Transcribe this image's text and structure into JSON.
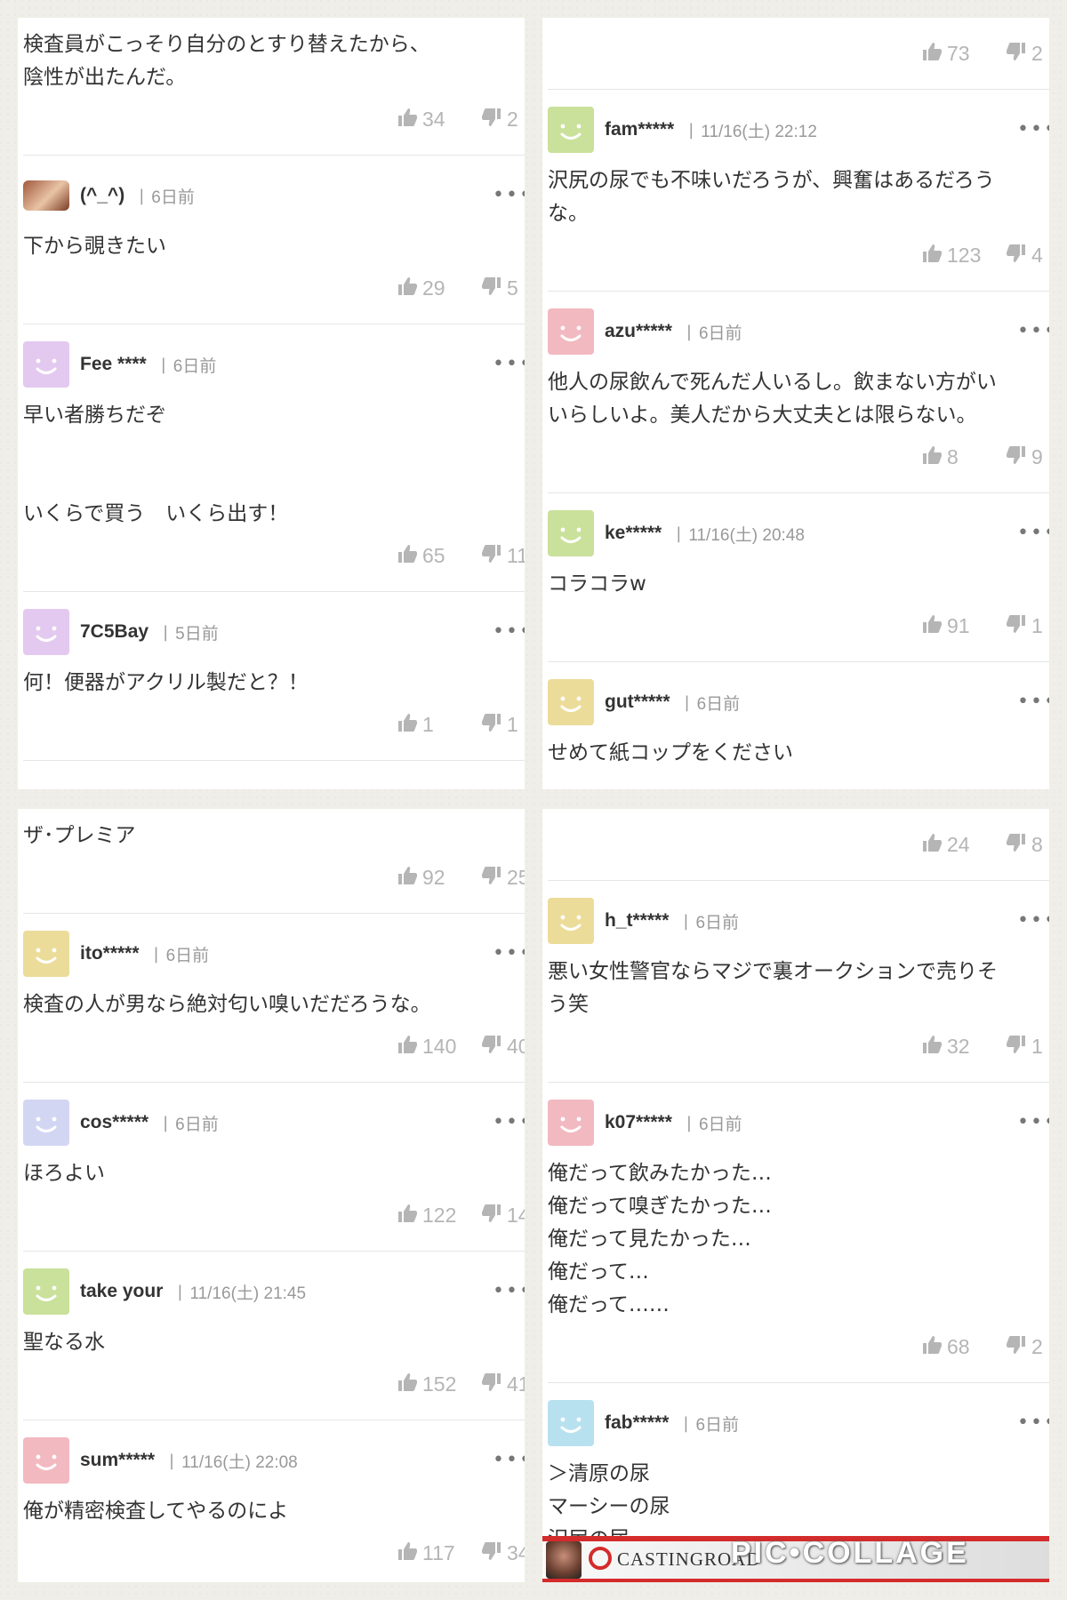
{
  "panels": [
    {
      "comments": [
        {
          "type": "cont",
          "text": "検査員がこっそり自分のとすり替えたから、\n陰性が出たんだ。",
          "up": "34",
          "down": "2"
        },
        {
          "user": "(^_^)",
          "time": "6日前",
          "avatar": "photo",
          "text": "下から覗きたい",
          "up": "29",
          "down": "5"
        },
        {
          "user": "Fee ****",
          "time": "6日前",
          "avatar": "#e3c9ef",
          "text": "早い者勝ちだぞ\n\n\nいくらで買う　いくら出す！",
          "up": "65",
          "down": "11"
        },
        {
          "user": "7C5Bay",
          "time": "5日前",
          "avatar": "#e3c9ef",
          "text": "何！便器がアクリル製だと？！",
          "up": "1",
          "down": "1"
        }
      ]
    },
    {
      "comments": [
        {
          "type": "votes-only",
          "up": "73",
          "down": "2"
        },
        {
          "user": "fam*****",
          "time": "11/16(土) 22:12",
          "avatar": "#c9e19a",
          "text": "沢尻の尿でも不味いだろうが、興奮はあるだろう\nな。",
          "up": "123",
          "down": "4"
        },
        {
          "user": "azu*****",
          "time": "6日前",
          "avatar": "#f2b9c0",
          "text": "他人の尿飲んで死んだ人いるし。飲まない方がい\nいらしいよ。美人だから大丈夫とは限らない。",
          "up": "8",
          "down": "9"
        },
        {
          "user": "ke*****",
          "time": "11/16(土) 20:48",
          "avatar": "#c9e19a",
          "text": "コラコラw",
          "up": "91",
          "down": "1"
        },
        {
          "user": "gut*****",
          "time": "6日前",
          "avatar": "#ecdc9a",
          "text": "せめて紙コップをください",
          "up": "",
          "down": ""
        }
      ]
    },
    {
      "comments": [
        {
          "type": "cont",
          "text": "ザ･プレミア",
          "up": "92",
          "down": "25"
        },
        {
          "user": "ito*****",
          "time": "6日前",
          "avatar": "#ecdc9a",
          "text": "検査の人が男なら絶対匂い嗅いだだろうな。",
          "up": "140",
          "down": "40"
        },
        {
          "user": "cos*****",
          "time": "6日前",
          "avatar": "#d3d6f3",
          "text": "ほろよい",
          "up": "122",
          "down": "14"
        },
        {
          "user": "take your",
          "time": "11/16(土) 21:45",
          "avatar": "#c9e19a",
          "text": "聖なる水",
          "up": "152",
          "down": "41"
        },
        {
          "user": "sum*****",
          "time": "11/16(土) 22:08",
          "avatar": "#f2b9c0",
          "text": "俺が精密検査してやるのによ",
          "up": "117",
          "down": "34"
        }
      ]
    },
    {
      "comments": [
        {
          "type": "votes-only",
          "up": "24",
          "down": "8"
        },
        {
          "user": "h_t*****",
          "time": "6日前",
          "avatar": "#ecdc9a",
          "text": "悪い女性警官ならマジで裏オークションで売りそ\nう笑",
          "up": "32",
          "down": "1"
        },
        {
          "user": "k07*****",
          "time": "6日前",
          "avatar": "#f2b9c0",
          "text": "俺だって飲みたかった…\n俺だって嗅ぎたかった…\n俺だって見たかった…\n俺だって…\n俺だって……",
          "up": "68",
          "down": "2"
        },
        {
          "user": "fab*****",
          "time": "6日前",
          "avatar": "#b8e1ef",
          "text": "＞清原の尿\nマーシーの尿\n沢尻の尿",
          "up": "",
          "down": ""
        }
      ],
      "banner": {
        "brand": "CASTINGROAD",
        "watermark": "PIC•COLLAGE"
      }
    }
  ]
}
